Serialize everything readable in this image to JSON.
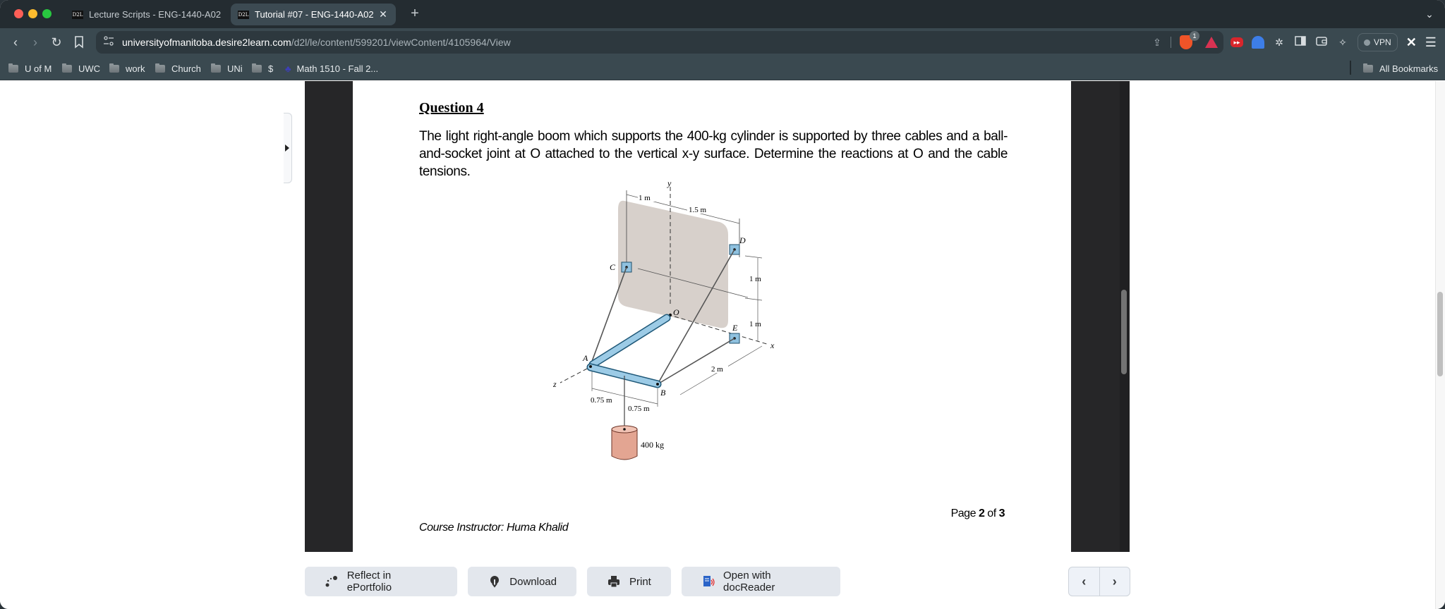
{
  "browser": {
    "tabs": [
      {
        "favicon": "D2L",
        "title": "Lecture Scripts - ENG-1440-A02",
        "active": false
      },
      {
        "favicon": "D2L",
        "title": "Tutorial #07 - ENG-1440-A02",
        "active": true
      }
    ],
    "new_tab_icon": "+",
    "tab_menu_icon": "chevron-down",
    "url_host": "universityofmanitoba.desire2learn.com",
    "url_path": "/d2l/le/content/599201/viewContent/4105964/View",
    "shields_badge": "1",
    "vpn_label": "VPN",
    "bookmarks": [
      {
        "label": "U of M",
        "icon": "folder"
      },
      {
        "label": "UWC",
        "icon": "folder"
      },
      {
        "label": "work",
        "icon": "folder"
      },
      {
        "label": "Church",
        "icon": "folder"
      },
      {
        "label": "UNi",
        "icon": "folder"
      },
      {
        "label": "$",
        "icon": "folder"
      },
      {
        "label": "Math 1510 - Fall 2...",
        "icon": "site"
      }
    ],
    "all_bookmarks_label": "All Bookmarks"
  },
  "document": {
    "question_title": "Question 4",
    "question_text": "The light right-angle boom which supports the 400-kg cylinder is supported by three cables and a ball-and-socket joint at O attached to the vertical x-y surface. Determine the reactions at O and the cable tensions.",
    "figure": {
      "labels": {
        "y": "y",
        "x": "x",
        "z": "z",
        "A": "A",
        "B": "B",
        "C": "C",
        "D": "D",
        "E": "E",
        "O": "O",
        "dim_1m_top": "1 m",
        "dim_1_5m": "1.5 m",
        "dim_1m_right_upper": "1 m",
        "dim_1m_right_lower": "1 m",
        "dim_2m": "2 m",
        "dim_075_left": "0.75 m",
        "dim_075_right": "0.75 m",
        "mass": "400 kg"
      }
    },
    "page_prefix": "Page",
    "page_current": "2",
    "page_of": "of",
    "page_total": "3",
    "instructor": "Course Instructor: Huma Khalid"
  },
  "actions": {
    "reflect": "Reflect in ePortfolio",
    "download": "Download",
    "print": "Print",
    "docreader": "Open with docReader"
  },
  "pager": {
    "prev_icon": "‹",
    "next_icon": "›"
  }
}
